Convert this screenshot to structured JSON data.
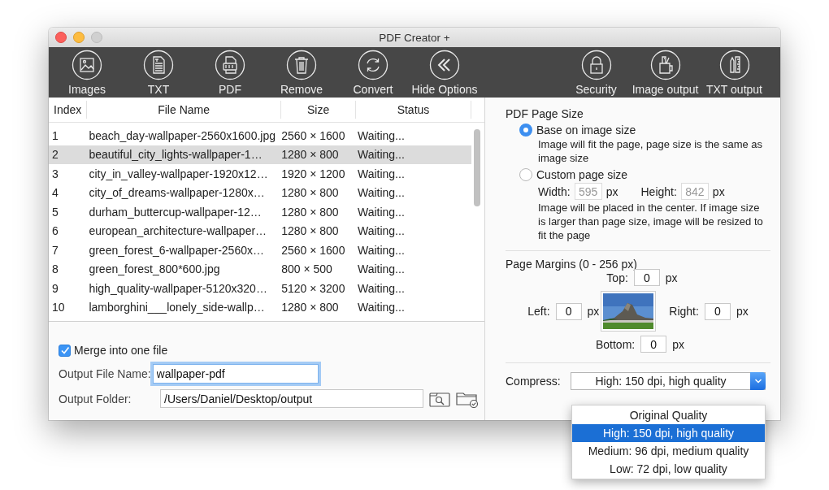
{
  "window": {
    "title": "PDF Creator +"
  },
  "toolbar": {
    "left": [
      {
        "label": "Images"
      },
      {
        "label": "TXT"
      },
      {
        "label": "PDF"
      },
      {
        "label": "Remove"
      },
      {
        "label": "Convert"
      },
      {
        "label": "Hide Options"
      }
    ],
    "right": [
      {
        "label": "Security"
      },
      {
        "label": "Image output"
      },
      {
        "label": "TXT output"
      }
    ]
  },
  "table": {
    "columns": [
      "Index",
      "File Name",
      "Size",
      "Status"
    ],
    "rows": [
      {
        "cells": [
          "1",
          "beach_day-wallpaper-2560x1600.jpg",
          "2560 × 1600",
          "Waiting..."
        ],
        "selected": false
      },
      {
        "cells": [
          "2",
          "beautiful_city_lights-wallpaper-1…",
          "1280 × 800",
          "Waiting..."
        ],
        "selected": true
      },
      {
        "cells": [
          "3",
          "city_in_valley-wallpaper-1920x12…",
          "1920 × 1200",
          "Waiting..."
        ],
        "selected": false
      },
      {
        "cells": [
          "4",
          "city_of_dreams-wallpaper-1280x…",
          "1280 × 800",
          "Waiting..."
        ],
        "selected": false
      },
      {
        "cells": [
          "5",
          "durham_buttercup-wallpaper-12…",
          "1280 × 800",
          "Waiting..."
        ],
        "selected": false
      },
      {
        "cells": [
          "6",
          "european_architecture-wallpaper…",
          "1280 × 800",
          "Waiting..."
        ],
        "selected": false
      },
      {
        "cells": [
          "7",
          "green_forest_6-wallpaper-2560x…",
          "2560 × 1600",
          "Waiting..."
        ],
        "selected": false
      },
      {
        "cells": [
          "8",
          "green_forest_800*600.jpg",
          "800 × 500",
          "Waiting..."
        ],
        "selected": false
      },
      {
        "cells": [
          "9",
          "high_quality-wallpaper-5120x320…",
          "5120 × 3200",
          "Waiting..."
        ],
        "selected": false
      },
      {
        "cells": [
          "10",
          "lamborghini___lonely_side-wallp…",
          "1280 × 800",
          "Waiting..."
        ],
        "selected": false
      }
    ]
  },
  "merge": {
    "label": "Merge into one file",
    "checked": true
  },
  "output_file_name": {
    "label": "Output File Name:",
    "value": "wallpaper-pdf",
    "focused": true
  },
  "output_folder": {
    "label": "Output Folder:",
    "value": "/Users/Daniel/Desktop/output"
  },
  "page_size": {
    "title": "PDF Page Size",
    "options": [
      {
        "label": "Base on image size",
        "selected": true,
        "description": "Image will fit the page, page size is the same as image size"
      },
      {
        "label": "Custom page size",
        "selected": false,
        "width": {
          "label": "Width:",
          "value": "595",
          "unit": "px",
          "disabled": true
        },
        "height": {
          "label": "Height:",
          "value": "842",
          "unit": "px",
          "disabled": true
        },
        "description": "Image will be placed in the center. If image size is larger than page size, image will be resized to fit the page"
      }
    ]
  },
  "margins": {
    "title": "Page Margins (0 - 256 px)",
    "top": {
      "label": "Top:",
      "value": "0",
      "unit": "px"
    },
    "left": {
      "label": "Left:",
      "value": "0",
      "unit": "px"
    },
    "right": {
      "label": "Right:",
      "value": "0",
      "unit": "px"
    },
    "bottom": {
      "label": "Bottom:",
      "value": "0",
      "unit": "px"
    }
  },
  "compress": {
    "label": "Compress:",
    "value": "High: 150 dpi, high quality",
    "expanded": true,
    "options": [
      {
        "label": "Original Quality",
        "selected": false
      },
      {
        "label": "High: 150 dpi, high quality",
        "selected": true
      },
      {
        "label": "Medium: 96 dpi, medium quality",
        "selected": false
      },
      {
        "label": "Low: 72 dpi, low quality",
        "selected": false
      }
    ]
  }
}
